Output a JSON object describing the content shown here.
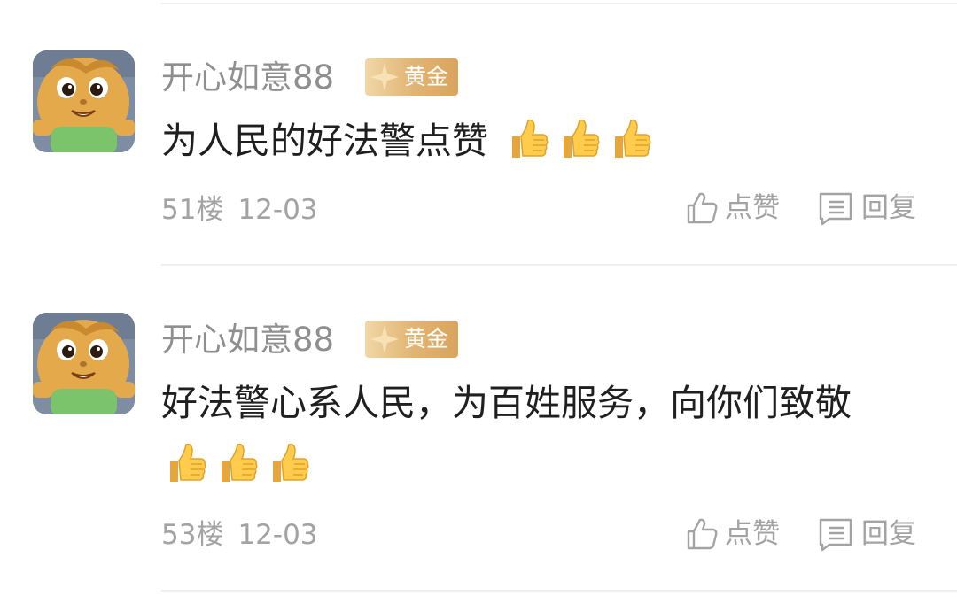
{
  "comments": [
    {
      "username": "开心如意88",
      "badge": "黄金",
      "text": "为人民的好法警点赞",
      "thumbs_count": 3,
      "floor": "51楼",
      "date": "12-03",
      "like_label": "点赞",
      "reply_label": "回复"
    },
    {
      "username": "开心如意88",
      "badge": "黄金",
      "text": "好法警心系人民，为百姓服务，向你们致敬",
      "thumbs_count": 3,
      "floor": "53楼",
      "date": "12-03",
      "like_label": "点赞",
      "reply_label": "回复"
    }
  ],
  "icons": {
    "thumbs": "thumbs-up-emoji-icon",
    "like": "thumb-up-outline-icon",
    "reply": "reply-outline-icon",
    "badge": "star-icon"
  },
  "colors": {
    "username": "#8f8f8f",
    "text": "#1f1f1f",
    "meta": "#a3a3a3",
    "badge_gradient_start": "#f1d7a6",
    "badge_gradient_end": "#d9a45d"
  }
}
